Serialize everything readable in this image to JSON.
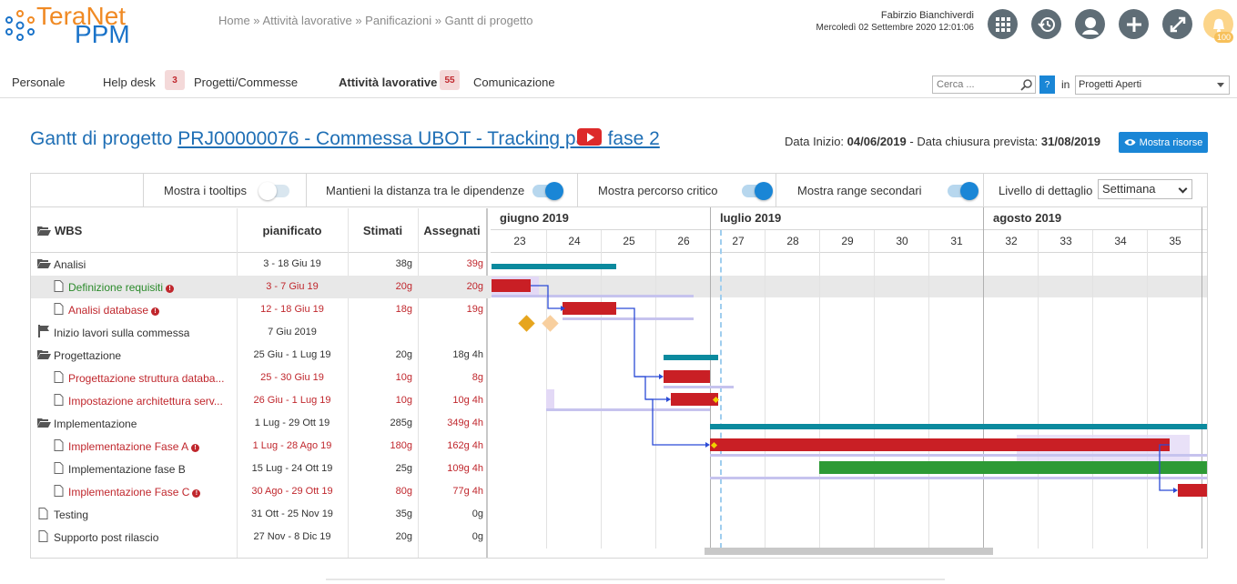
{
  "header": {
    "logo_top": "TeraNet",
    "logo_bottom": "PPM",
    "breadcrumb": [
      "Home",
      "Attività lavorative",
      "Panificazioni",
      "Gantt di progetto"
    ],
    "user_name": "Fabirzio Bianchiverdi",
    "user_datetime": "Mercoledì 02 Settembre 2020 12:01:06",
    "notification_count": "100"
  },
  "nav": {
    "items": [
      {
        "label": "Personale"
      },
      {
        "label": "Help desk",
        "badge": "3"
      },
      {
        "label": "Progetti/Commesse"
      },
      {
        "label": "Attività lavorative",
        "badge": "55"
      },
      {
        "label": "Comunicazione"
      }
    ],
    "search_placeholder": "Cerca ...",
    "help_label": "?",
    "in_label": "in",
    "scope_value": "Progetti Aperti"
  },
  "title": {
    "prefix": "Gantt di progetto ",
    "link": "PRJ00000076 - Commessa UBOT - Tracking path fase 2",
    "start_label": "Data Inizio:",
    "start_value": "04/06/2019",
    "sep": "-",
    "end_label": "Data chiusura prevista:",
    "end_value": "31/08/2019",
    "resources_button": "Mostra risorse"
  },
  "toolbar": {
    "tooltips": "Mostra i tooltips",
    "distance": "Mantieni la distanza tra le dipendenze",
    "critical": "Mostra percorso critico",
    "secondary": "Mostra range secondari",
    "detail_label": "Livello di dettaglio",
    "detail_value": "Settimana"
  },
  "table": {
    "headers": {
      "wbs": "WBS",
      "planned": "pianificato",
      "estimated": "Stimati",
      "assigned": "Assegnati"
    },
    "rows": [
      {
        "name": "Analisi",
        "planned": "3 - 18 Giu 19",
        "est": "38g",
        "ass": "39g"
      },
      {
        "name": "Definizione requisiti",
        "planned": "3 - 7 Giu 19",
        "est": "20g",
        "ass": "20g"
      },
      {
        "name": "Analisi database",
        "planned": "12 - 18 Giu 19",
        "est": "18g",
        "ass": "19g"
      },
      {
        "name": "Inizio lavori sulla commessa",
        "planned": "7 Giu 2019",
        "est": "",
        "ass": ""
      },
      {
        "name": "Progettazione",
        "planned": "25 Giu - 1 Lug 19",
        "est": "20g",
        "ass": "18g 4h"
      },
      {
        "name": "Progettazione struttura databa...",
        "planned": "25 - 30 Giu 19",
        "est": "10g",
        "ass": "8g"
      },
      {
        "name": "Impostazione architettura serv...",
        "planned": "26 Giu - 1 Lug 19",
        "est": "10g",
        "ass": "10g 4h"
      },
      {
        "name": "Implementazione",
        "planned": "1 Lug - 29 Ott 19",
        "est": "285g",
        "ass": "349g 4h"
      },
      {
        "name": "Implementazione Fase A",
        "planned": "1 Lug - 28 Ago 19",
        "est": "180g",
        "ass": "162g 4h"
      },
      {
        "name": "Implementazione fase B",
        "planned": "15 Lug - 24 Ott 19",
        "est": "25g",
        "ass": "109g 4h"
      },
      {
        "name": "Implementazione Fase C",
        "planned": "30 Ago - 29 Ott 19",
        "est": "80g",
        "ass": "77g 4h"
      },
      {
        "name": "Testing",
        "planned": "31 Ott - 25 Nov 19",
        "est": "35g",
        "ass": "0g"
      },
      {
        "name": "Supporto post rilascio",
        "planned": "27 Nov - 8 Dic 19",
        "est": "20g",
        "ass": "0g"
      }
    ]
  },
  "gantt": {
    "months": [
      "giugno 2019",
      "luglio 2019",
      "agosto 2019"
    ],
    "weeks": [
      "23",
      "24",
      "25",
      "26",
      "27",
      "28",
      "29",
      "30",
      "31",
      "32",
      "33",
      "34",
      "35"
    ]
  }
}
